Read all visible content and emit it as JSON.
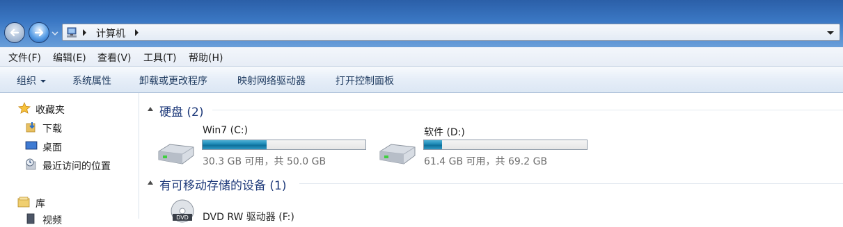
{
  "address": {
    "location": "计算机"
  },
  "menu": [
    "文件(F)",
    "编辑(E)",
    "查看(V)",
    "工具(T)",
    "帮助(H)"
  ],
  "commands": [
    "组织",
    "系统属性",
    "卸载或更改程序",
    "映射网络驱动器",
    "打开控制面板"
  ],
  "nav": {
    "favorites": "收藏夹",
    "favorites_items": [
      "下载",
      "桌面",
      "最近访问的位置"
    ],
    "libraries": "库",
    "library_items": [
      "视频"
    ]
  },
  "groups": {
    "hard_disks": "硬盘 (2)",
    "removable": "有可移动存储的设备 (1)"
  },
  "drives": [
    {
      "name": "Win7 (C:)",
      "free": "30.3 GB 可用，共 50.0 GB",
      "used_fraction": 0.394
    },
    {
      "name": "软件 (D:)",
      "free": "61.4 GB 可用，共 69.2 GB",
      "used_fraction": 0.113
    }
  ],
  "removable_drives": [
    {
      "name": "DVD RW 驱动器 (F:)"
    }
  ],
  "icons": {
    "back": "back-arrow-icon",
    "forward": "forward-arrow-icon",
    "computer": "computer-icon",
    "star": "star-icon",
    "drive": "hard-drive-icon",
    "dvd": "dvd-drive-icon"
  },
  "colors": {
    "accent": "#3b78c4",
    "bar_fill": "#1a87b5",
    "group_header": "#1e3a7a"
  }
}
